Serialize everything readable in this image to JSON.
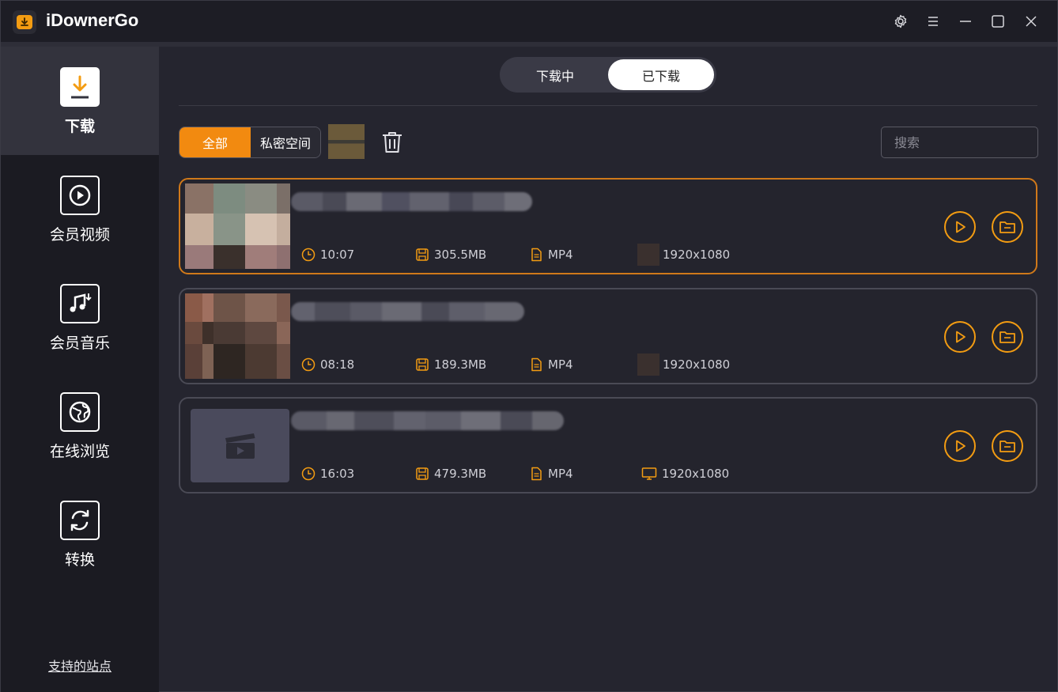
{
  "app": {
    "title": "iDownerGo"
  },
  "sidebar": {
    "items": [
      {
        "label": "下载",
        "icon": "download-icon",
        "active": true
      },
      {
        "label": "会员视频",
        "icon": "play-icon",
        "active": false
      },
      {
        "label": "会员音乐",
        "icon": "music-icon",
        "active": false
      },
      {
        "label": "在线浏览",
        "icon": "globe-icon",
        "active": false
      },
      {
        "label": "转换",
        "icon": "convert-icon",
        "active": false
      }
    ],
    "supported_sites": "支持的站点"
  },
  "tabs": {
    "downloading": "下载中",
    "downloaded": "已下载",
    "active": "downloaded"
  },
  "filters": {
    "all": "全部",
    "private": "私密空间"
  },
  "search": {
    "placeholder": "搜索"
  },
  "accent_color": "#f39c12",
  "items": [
    {
      "duration": "10:07",
      "size": "305.5MB",
      "format": "MP4",
      "resolution": "1920x1080",
      "selected": true
    },
    {
      "duration": "08:18",
      "size": "189.3MB",
      "format": "MP4",
      "resolution": "1920x1080",
      "selected": false
    },
    {
      "duration": "16:03",
      "size": "479.3MB",
      "format": "MP4",
      "resolution": "1920x1080",
      "selected": false
    }
  ]
}
